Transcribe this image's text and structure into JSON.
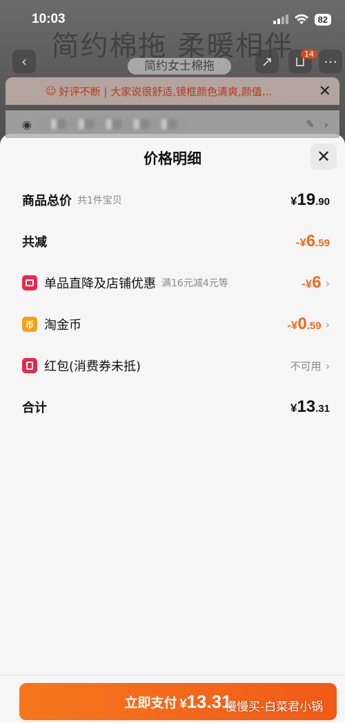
{
  "status_bar": {
    "time": "10:03",
    "battery": "82"
  },
  "background": {
    "banner_title": "简约棉拖  柔暖相伴",
    "pill_label": "简约女士棉拖",
    "cart_badge": "14",
    "notice_text": "好评不断 | 大家说很舒适,镜框颜色清爽,颜值..."
  },
  "sheet": {
    "title": "价格明细",
    "rows": {
      "total": {
        "label": "商品总价",
        "sub": "共1件宝贝",
        "sym": "¥",
        "int": "19",
        "dec": ".90"
      },
      "discount": {
        "label": "共减",
        "sym": "-¥",
        "int": "6",
        "dec": ".59"
      },
      "store_discount": {
        "label": "单品直降及店铺优惠",
        "sub": "满16元减4元等",
        "sym": "-¥",
        "int": "6",
        "dec": ""
      },
      "coins": {
        "label": "淘金币",
        "icon_text": "币",
        "sym": "-¥",
        "int": "0",
        "dec": ".59"
      },
      "red_packet": {
        "label": "红包(消费券未抵)",
        "status": "不可用"
      },
      "sum": {
        "label": "合计",
        "sym": "¥",
        "int": "13",
        "dec": ".31"
      }
    }
  },
  "footer": {
    "pay_label": "立即支付",
    "pay_sym": "¥",
    "pay_amount": "13.31",
    "watermark": "慢慢买-白菜君小锅"
  },
  "colors": {
    "accent": "#f06a1e",
    "badge_red": "#e8294a",
    "badge_gold": "#f5a11a"
  }
}
